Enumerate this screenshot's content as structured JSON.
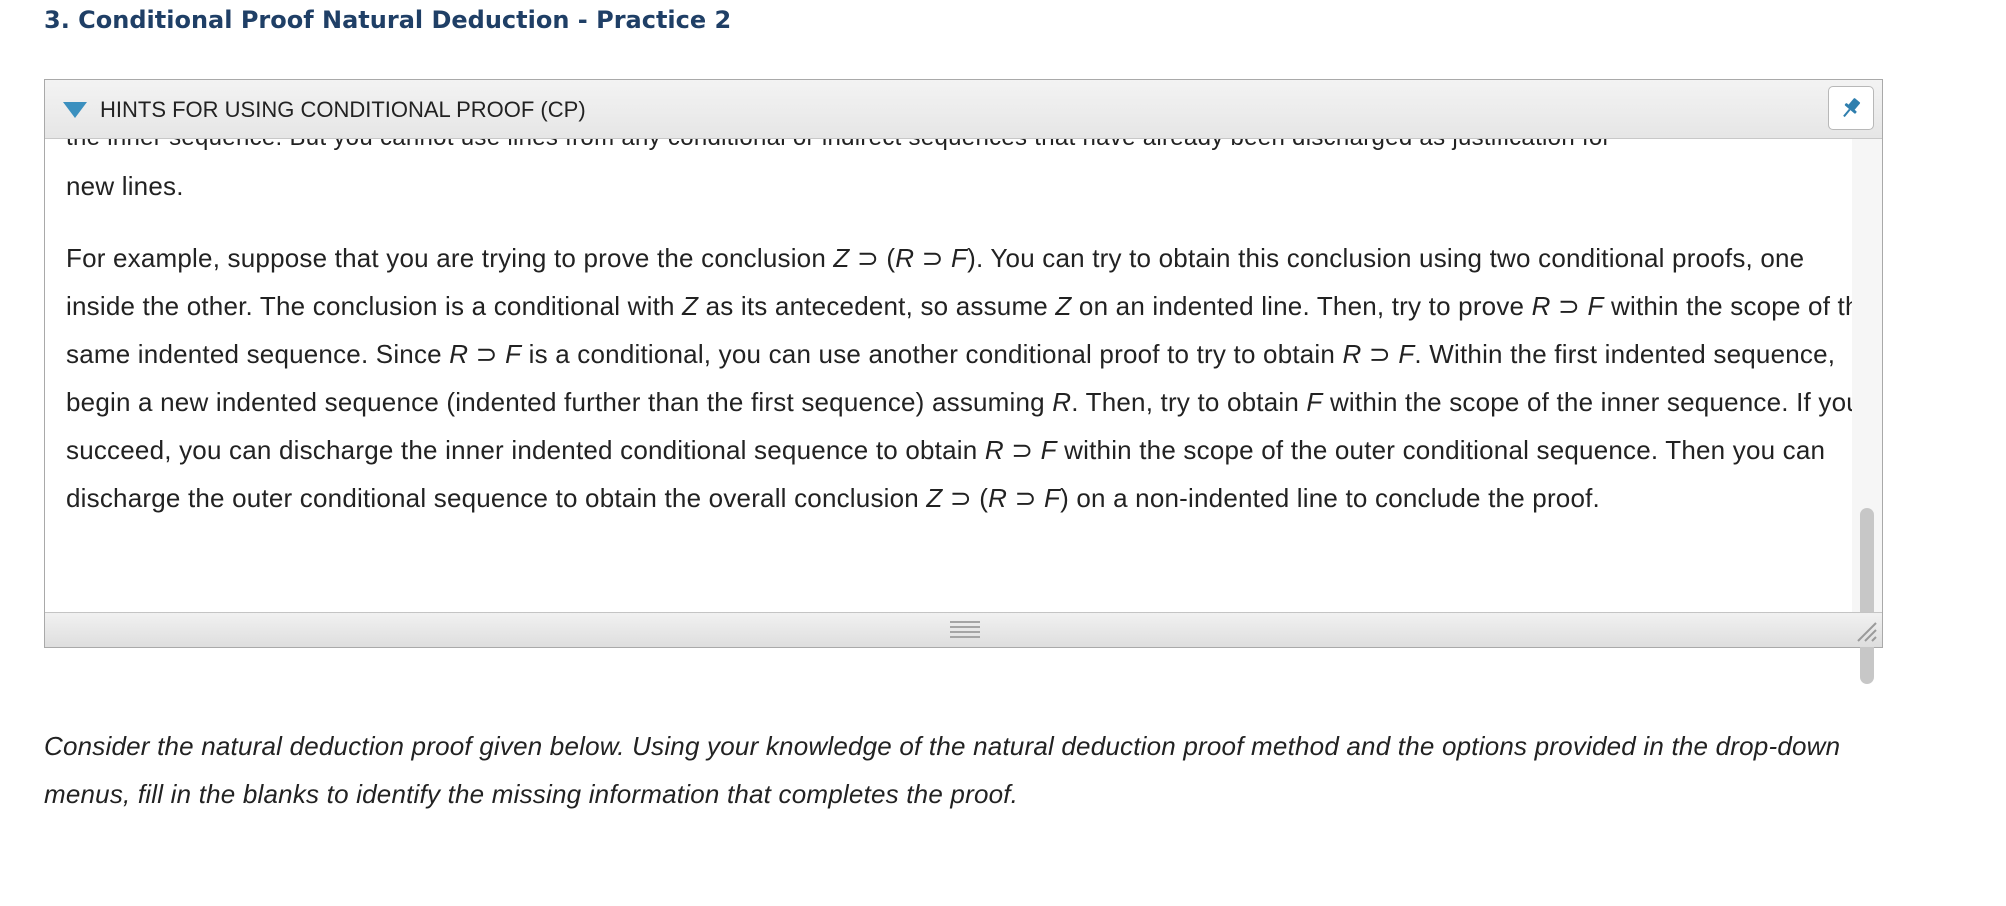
{
  "page": {
    "title": "3. Conditional Proof Natural Deduction - Practice 2"
  },
  "hints": {
    "header_label": "HINTS FOR USING CONDITIONAL PROOF (CP)",
    "cut_line": "the inner sequence. But you cannot use lines from any conditional or indirect sequences that have already been discharged as justification for",
    "para1": "new lines.",
    "para2": "For example, suppose that you are trying to prove the conclusion Z ⊃ (R ⊃ F). You can try to obtain this conclusion using two conditional proofs, one inside the other. The conclusion is a conditional with Z as its antecedent, so assume Z on an indented line. Then, try to prove R ⊃ F within the scope of the same indented sequence. Since R ⊃ F is a conditional, you can use another conditional proof to try to obtain R ⊃ F. Within the first indented sequence, begin a new indented sequence (indented further than the first sequence) assuming R. Then, try to obtain F within the scope of the inner sequence. If you succeed, you can discharge the inner indented conditional sequence to obtain R ⊃ F within the scope of the outer conditional sequence. Then you can discharge the outer conditional sequence to obtain the overall conclusion Z ⊃ (R ⊃ F) on a non-indented line to conclude the proof.",
    "icons": {
      "toggle": "triangle-down-icon",
      "pin": "pin-icon",
      "grip": "drag-grip-icon",
      "resize": "resize-handle-icon"
    },
    "colors": {
      "accent": "#3b90bf",
      "title": "#1f3f66"
    }
  },
  "question": {
    "text": "Consider the natural deduction proof given below. Using your knowledge of the natural deduction proof method and the options provided in the drop-down menus, fill in the blanks to identify the missing information that completes the proof."
  }
}
